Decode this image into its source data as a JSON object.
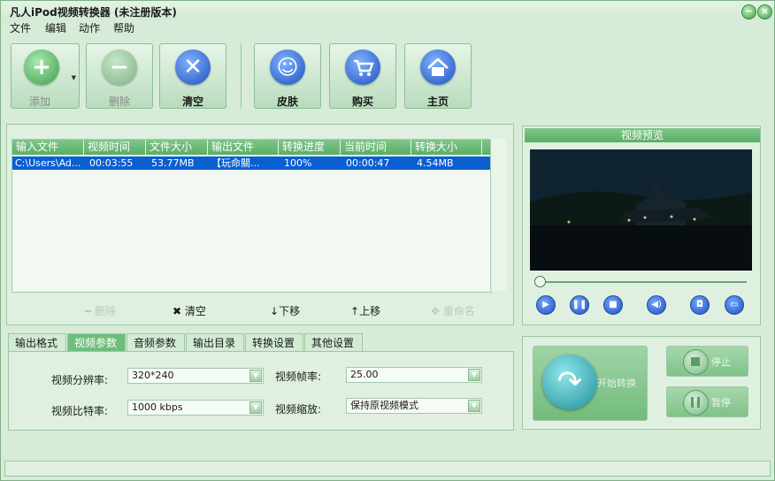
{
  "window": {
    "title": "凡人iPod视频转换器 (未注册版本)"
  },
  "menu": [
    "文件",
    "编辑",
    "动作",
    "帮助"
  ],
  "toolbar": {
    "add": "添加",
    "delete": "删除",
    "clear": "清空",
    "skin": "皮肤",
    "buy": "购买",
    "home": "主页"
  },
  "table": {
    "columns": [
      "输入文件",
      "视频时间",
      "文件大小",
      "输出文件",
      "转换进度",
      "当前时间",
      "转换大小"
    ],
    "rows": [
      {
        "input": "C:\\Users\\Ad...",
        "duration": "00:03:55",
        "size": "53.77MB",
        "output": "【玩命關...",
        "progress": "100%",
        "current": "00:00:47",
        "converted": "4.54MB"
      }
    ]
  },
  "list_tools": {
    "delete": "删除",
    "clear": "清空",
    "down": "下移",
    "up": "上移",
    "rename": "重命名"
  },
  "tabs": [
    "输出格式",
    "视频参数",
    "音频参数",
    "输出目录",
    "转换设置",
    "其他设置"
  ],
  "active_tab": "视频参数",
  "video_params": {
    "resolution_label": "视频分辨率:",
    "resolution_value": "320*240",
    "framerate_label": "视频帧率:",
    "framerate_value": "25.00",
    "bitrate_label": "视频比特率:",
    "bitrate_value": "1000 kbps",
    "scale_label": "视频缩放:",
    "scale_value": "保持原视频模式"
  },
  "preview": {
    "title": "视频预览",
    "seek_position": 0
  },
  "actions": {
    "start": "开始转换",
    "stop": "停止",
    "pause": "暂停"
  },
  "colors": {
    "accent": "#5aae66",
    "selection": "#0a5fd1",
    "background": "#d6ecd8"
  }
}
